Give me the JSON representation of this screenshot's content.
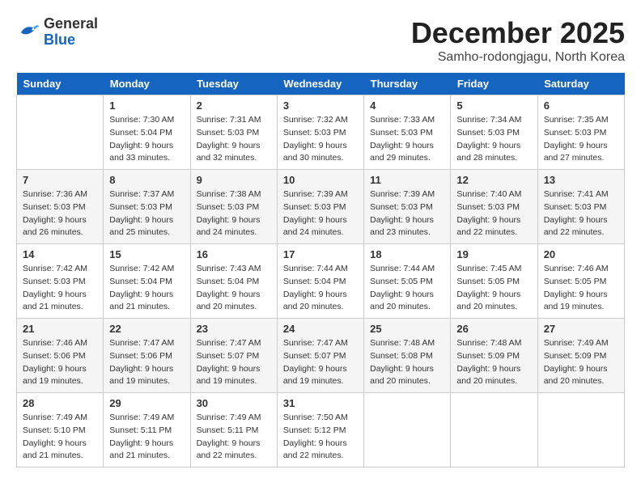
{
  "logo": {
    "text_general": "General",
    "text_blue": "Blue"
  },
  "title": "December 2025",
  "subtitle": "Samho-rodongjagu, North Korea",
  "header_days": [
    "Sunday",
    "Monday",
    "Tuesday",
    "Wednesday",
    "Thursday",
    "Friday",
    "Saturday"
  ],
  "weeks": [
    [
      {
        "day": "",
        "sunrise": "",
        "sunset": "",
        "daylight": ""
      },
      {
        "day": "1",
        "sunrise": "Sunrise: 7:30 AM",
        "sunset": "Sunset: 5:04 PM",
        "daylight": "Daylight: 9 hours and 33 minutes."
      },
      {
        "day": "2",
        "sunrise": "Sunrise: 7:31 AM",
        "sunset": "Sunset: 5:03 PM",
        "daylight": "Daylight: 9 hours and 32 minutes."
      },
      {
        "day": "3",
        "sunrise": "Sunrise: 7:32 AM",
        "sunset": "Sunset: 5:03 PM",
        "daylight": "Daylight: 9 hours and 30 minutes."
      },
      {
        "day": "4",
        "sunrise": "Sunrise: 7:33 AM",
        "sunset": "Sunset: 5:03 PM",
        "daylight": "Daylight: 9 hours and 29 minutes."
      },
      {
        "day": "5",
        "sunrise": "Sunrise: 7:34 AM",
        "sunset": "Sunset: 5:03 PM",
        "daylight": "Daylight: 9 hours and 28 minutes."
      },
      {
        "day": "6",
        "sunrise": "Sunrise: 7:35 AM",
        "sunset": "Sunset: 5:03 PM",
        "daylight": "Daylight: 9 hours and 27 minutes."
      }
    ],
    [
      {
        "day": "7",
        "sunrise": "Sunrise: 7:36 AM",
        "sunset": "Sunset: 5:03 PM",
        "daylight": "Daylight: 9 hours and 26 minutes."
      },
      {
        "day": "8",
        "sunrise": "Sunrise: 7:37 AM",
        "sunset": "Sunset: 5:03 PM",
        "daylight": "Daylight: 9 hours and 25 minutes."
      },
      {
        "day": "9",
        "sunrise": "Sunrise: 7:38 AM",
        "sunset": "Sunset: 5:03 PM",
        "daylight": "Daylight: 9 hours and 24 minutes."
      },
      {
        "day": "10",
        "sunrise": "Sunrise: 7:39 AM",
        "sunset": "Sunset: 5:03 PM",
        "daylight": "Daylight: 9 hours and 24 minutes."
      },
      {
        "day": "11",
        "sunrise": "Sunrise: 7:39 AM",
        "sunset": "Sunset: 5:03 PM",
        "daylight": "Daylight: 9 hours and 23 minutes."
      },
      {
        "day": "12",
        "sunrise": "Sunrise: 7:40 AM",
        "sunset": "Sunset: 5:03 PM",
        "daylight": "Daylight: 9 hours and 22 minutes."
      },
      {
        "day": "13",
        "sunrise": "Sunrise: 7:41 AM",
        "sunset": "Sunset: 5:03 PM",
        "daylight": "Daylight: 9 hours and 22 minutes."
      }
    ],
    [
      {
        "day": "14",
        "sunrise": "Sunrise: 7:42 AM",
        "sunset": "Sunset: 5:03 PM",
        "daylight": "Daylight: 9 hours and 21 minutes."
      },
      {
        "day": "15",
        "sunrise": "Sunrise: 7:42 AM",
        "sunset": "Sunset: 5:04 PM",
        "daylight": "Daylight: 9 hours and 21 minutes."
      },
      {
        "day": "16",
        "sunrise": "Sunrise: 7:43 AM",
        "sunset": "Sunset: 5:04 PM",
        "daylight": "Daylight: 9 hours and 20 minutes."
      },
      {
        "day": "17",
        "sunrise": "Sunrise: 7:44 AM",
        "sunset": "Sunset: 5:04 PM",
        "daylight": "Daylight: 9 hours and 20 minutes."
      },
      {
        "day": "18",
        "sunrise": "Sunrise: 7:44 AM",
        "sunset": "Sunset: 5:05 PM",
        "daylight": "Daylight: 9 hours and 20 minutes."
      },
      {
        "day": "19",
        "sunrise": "Sunrise: 7:45 AM",
        "sunset": "Sunset: 5:05 PM",
        "daylight": "Daylight: 9 hours and 20 minutes."
      },
      {
        "day": "20",
        "sunrise": "Sunrise: 7:46 AM",
        "sunset": "Sunset: 5:05 PM",
        "daylight": "Daylight: 9 hours and 19 minutes."
      }
    ],
    [
      {
        "day": "21",
        "sunrise": "Sunrise: 7:46 AM",
        "sunset": "Sunset: 5:06 PM",
        "daylight": "Daylight: 9 hours and 19 minutes."
      },
      {
        "day": "22",
        "sunrise": "Sunrise: 7:47 AM",
        "sunset": "Sunset: 5:06 PM",
        "daylight": "Daylight: 9 hours and 19 minutes."
      },
      {
        "day": "23",
        "sunrise": "Sunrise: 7:47 AM",
        "sunset": "Sunset: 5:07 PM",
        "daylight": "Daylight: 9 hours and 19 minutes."
      },
      {
        "day": "24",
        "sunrise": "Sunrise: 7:47 AM",
        "sunset": "Sunset: 5:07 PM",
        "daylight": "Daylight: 9 hours and 19 minutes."
      },
      {
        "day": "25",
        "sunrise": "Sunrise: 7:48 AM",
        "sunset": "Sunset: 5:08 PM",
        "daylight": "Daylight: 9 hours and 20 minutes."
      },
      {
        "day": "26",
        "sunrise": "Sunrise: 7:48 AM",
        "sunset": "Sunset: 5:09 PM",
        "daylight": "Daylight: 9 hours and 20 minutes."
      },
      {
        "day": "27",
        "sunrise": "Sunrise: 7:49 AM",
        "sunset": "Sunset: 5:09 PM",
        "daylight": "Daylight: 9 hours and 20 minutes."
      }
    ],
    [
      {
        "day": "28",
        "sunrise": "Sunrise: 7:49 AM",
        "sunset": "Sunset: 5:10 PM",
        "daylight": "Daylight: 9 hours and 21 minutes."
      },
      {
        "day": "29",
        "sunrise": "Sunrise: 7:49 AM",
        "sunset": "Sunset: 5:11 PM",
        "daylight": "Daylight: 9 hours and 21 minutes."
      },
      {
        "day": "30",
        "sunrise": "Sunrise: 7:49 AM",
        "sunset": "Sunset: 5:11 PM",
        "daylight": "Daylight: 9 hours and 22 minutes."
      },
      {
        "day": "31",
        "sunrise": "Sunrise: 7:50 AM",
        "sunset": "Sunset: 5:12 PM",
        "daylight": "Daylight: 9 hours and 22 minutes."
      },
      {
        "day": "",
        "sunrise": "",
        "sunset": "",
        "daylight": ""
      },
      {
        "day": "",
        "sunrise": "",
        "sunset": "",
        "daylight": ""
      },
      {
        "day": "",
        "sunrise": "",
        "sunset": "",
        "daylight": ""
      }
    ]
  ]
}
